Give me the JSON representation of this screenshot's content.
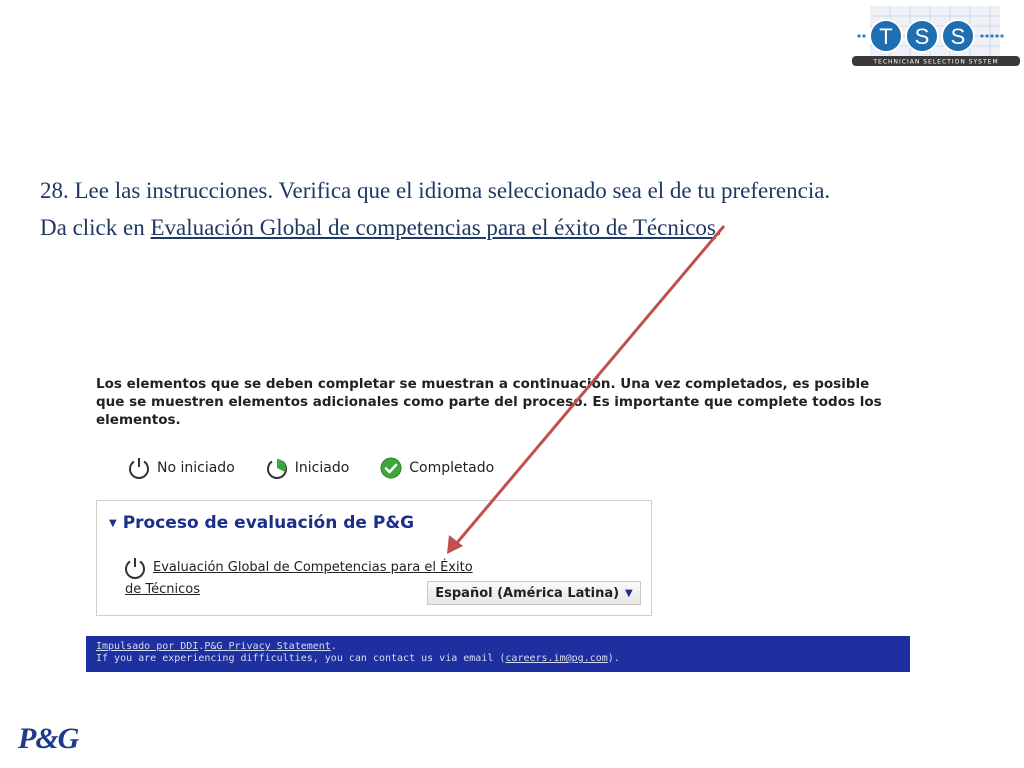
{
  "slide": {
    "instruction_line1": "28. Lee las instrucciones. Verifica que el idioma seleccionado sea el de tu preferencia.",
    "instruction_line2_prefix": "Da click en ",
    "instruction_line2_link": "Evaluación Global de competencias para el éxito de Técnicos",
    "instruction_line2_suffix": "."
  },
  "logos": {
    "tss_letters": [
      "T",
      "S",
      "S"
    ],
    "tss_tagline": "TECHNICIAN SELECTION SYSTEM",
    "pg": "P&G"
  },
  "screenshot": {
    "intro": "Los elementos que se deben completar se muestran a continuación. Una vez completados, es posible que se muestren elementos adicionales como parte del proceso. Es importante que complete todos los elementos.",
    "legend": {
      "not_started": "No iniciado",
      "started": "Iniciado",
      "completed": "Completado"
    },
    "process_title": "Proceso de evaluación de P&G",
    "item_link_line1": "Evaluación Global de Competencias para el Éxito",
    "item_link_line2": "de Técnicos",
    "language_selected": "Español (América Latina)",
    "footer": {
      "powered_by": "Impulsado por DDI",
      "privacy": "P&G Privacy Statement",
      "contact_prefix": "If you are experiencing difficulties, you can contact us via email (",
      "email": "careers.im@pg.com",
      "contact_suffix": ")."
    }
  },
  "colors": {
    "instruction_text": "#1f3864",
    "accent_blue": "#1a2f8a",
    "footer_bg": "#1e2fa0",
    "arrow": "#c0504d",
    "status_green": "#3aa83a"
  }
}
